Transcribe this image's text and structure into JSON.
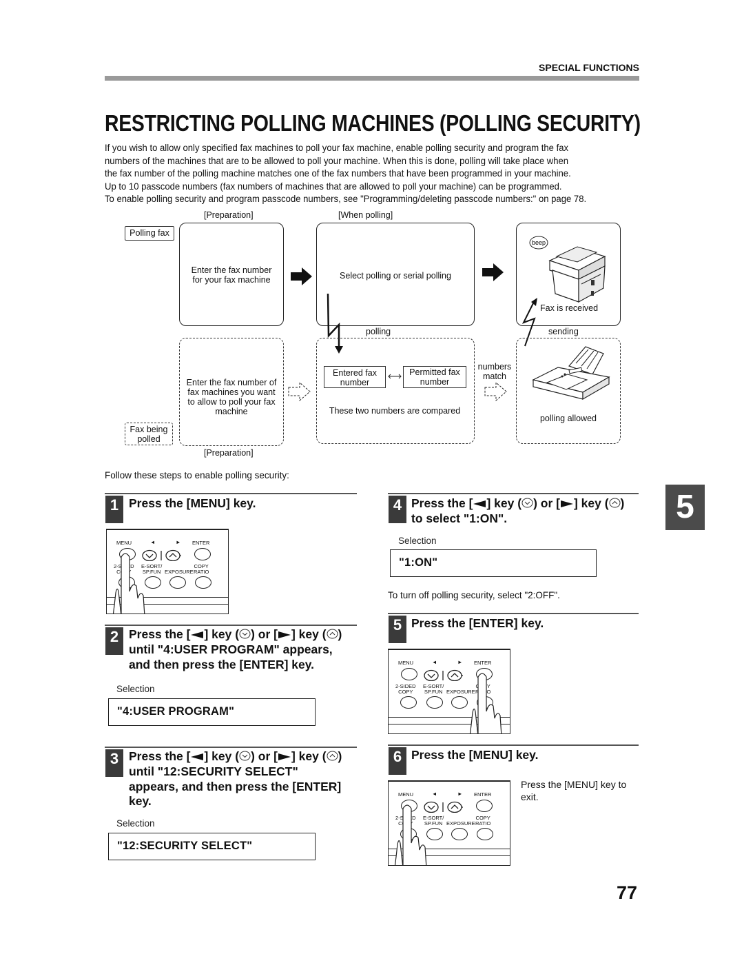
{
  "header": {
    "section": "SPECIAL FUNCTIONS",
    "title": "RESTRICTING POLLING MACHINES (POLLING SECURITY)"
  },
  "intro": [
    "If you wish to allow only specified fax machines to poll your fax machine, enable polling security and program the fax",
    "numbers of the machines that are to be allowed to poll your machine. When this is done, polling will take place when",
    "the fax number of the polling machine matches one of the fax numbers that have been programmed in your machine.",
    "Up to 10 passcode numbers (fax numbers of machines that are allowed to poll your machine) can be programmed.",
    "To enable polling security and program passcode numbers, see \"Programming/deleting passcode numbers:\" on page 78."
  ],
  "diagram": {
    "preparation_top": "[Preparation]",
    "when_polling": "[When polling]",
    "preparation_bottom": "[Preparation]",
    "polling_fax_label": "Polling fax",
    "fax_being_polled_label": [
      "Fax being",
      "polled"
    ],
    "prep_box_top": [
      "Enter the fax number",
      "for your fax machine"
    ],
    "polling_box_top": "Select polling or serial polling",
    "beep": "beep",
    "fax_received": "Fax is received",
    "polling_label": "polling",
    "sending_label": "sending",
    "prep_box_bottom": [
      "Enter the fax number of",
      "fax machines you want",
      "to allow to poll your fax",
      "machine"
    ],
    "entered_fax": [
      "Entered fax",
      "number"
    ],
    "permitted_fax": [
      "Permitted fax",
      "number"
    ],
    "compared": "These two numbers are compared",
    "numbers_match": [
      "numbers",
      "match"
    ],
    "polling_allowed": "polling allowed"
  },
  "lead_in": "Follow these steps to enable polling security:",
  "panel": {
    "menu": "MENU",
    "enter": "ENTER",
    "two_sided": [
      "2-SIDED",
      "COPY"
    ],
    "esort": [
      "E-SORT/",
      "SP.FUN"
    ],
    "exposure": "EXPOSURE",
    "copy_ratio": [
      "COPY",
      "RATIO"
    ],
    "left_arrow": "◄",
    "right_arrow": "►"
  },
  "steps": [
    {
      "num": "1",
      "title": [
        "Press the [MENU] key."
      ]
    },
    {
      "num": "2",
      "title_prefix": "Press the [",
      "key_mid": "] key (",
      "or": ") or [",
      "key_end": "] key (",
      "close": ")",
      "title_lines": [
        "until \"4:USER PROGRAM\" appears,",
        "and then press the [ENTER] key."
      ],
      "selection_label": "Selection",
      "selection_value": "\"4:USER PROGRAM\""
    },
    {
      "num": "3",
      "title_prefix": "Press the [",
      "key_mid": "] key (",
      "or": ") or [",
      "key_end": "] key (",
      "close": ")",
      "title_lines": [
        "until \"12:SECURITY SELECT\"",
        "appears, and then press the [ENTER]",
        "key."
      ],
      "selection_label": "Selection",
      "selection_value": "\"12:SECURITY SELECT\""
    },
    {
      "num": "4",
      "title_prefix": "Press the [",
      "key_mid": "] key (",
      "or": ") or [",
      "key_end": "] key (",
      "close": ")",
      "title_lines": [
        "to select \"1:ON\"."
      ],
      "selection_label": "Selection",
      "selection_value": "\"1:ON\"",
      "note": "To turn off polling security, select \"2:OFF\"."
    },
    {
      "num": "5",
      "title": [
        "Press the [ENTER] key."
      ]
    },
    {
      "num": "6",
      "title": [
        "Press the [MENU] key."
      ],
      "note": [
        "Press the [MENU] key to",
        "exit."
      ]
    }
  ],
  "chapter_tab": "5",
  "page_number": "77"
}
